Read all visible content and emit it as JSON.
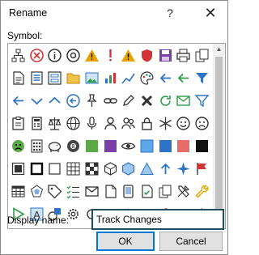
{
  "dialog": {
    "title": "Rename",
    "help_glyph": "?",
    "close_glyph": "✕"
  },
  "symbol_label": "Symbol:",
  "symbol_label_accel": "y",
  "display_name": {
    "label": "Display name:",
    "label_accel": "N",
    "value": "Track Changes"
  },
  "buttons": {
    "ok": "OK",
    "cancel": "Cancel"
  },
  "colors": {
    "accent_blue": "#2e74c6",
    "red": "#d13438",
    "orange": "#e8a200",
    "green": "#2e9e48",
    "purple": "#7a3fa8",
    "focus_border": "#1f4e5e"
  },
  "symbols": [
    [
      "sitemap-icon",
      "circle-x-icon",
      "info-icon",
      "at-icon",
      "warning-icon",
      "exclamation-icon",
      "warning-icon-2",
      "shield-icon",
      "save-icon",
      "print-icon",
      "copy-icon"
    ],
    [
      "document-icon",
      "document-list-icon",
      "form-icon",
      "folder-icon",
      "image-icon",
      "chart-icon",
      "chart-line-icon",
      "palette-icon",
      "arrow-left-icon",
      "arrow-left-2-icon",
      "filter-icon"
    ],
    [
      "arrow-left-icon",
      "chevron-down-icon",
      "chevron-up-icon",
      "arrow-left-circle-icon",
      "pin-icon",
      "link-icon",
      "pen-icon",
      "bold-x-icon",
      "refresh-icon",
      "mail-icon",
      "filter-outline-icon"
    ],
    [
      "clipboard-icon",
      "calculator-icon",
      "scales-icon",
      "globe-icon",
      "microphone-icon",
      "person-icon",
      "people-icon",
      "lock-icon",
      "snowflake-icon",
      "smile-icon",
      "sad-icon"
    ],
    [
      "sad-face-icon",
      "numpad-icon",
      "piggy-bank-icon",
      "number-8-icon",
      "swatch-green-icon",
      "swatch-purple-icon",
      "eye-icon",
      "swatch-blue-icon",
      "swatch-blue-dark-icon",
      "swatch-red-icon",
      "swatch-black-icon"
    ],
    [
      "box-icon",
      "box-bold-icon",
      "box-corners-icon",
      "grid-icon",
      "checker-icon",
      "cube-icon",
      "cube-blue-icon",
      "triangle-icon",
      "arrow-up-icon",
      "sparkle-icon",
      "flag-icon"
    ],
    [
      "table-icon",
      "spider-icon",
      "tag-icon",
      "checklist-icon",
      "envelope-icon",
      "page-icon",
      "tablet-icon",
      "document-ok-icon",
      "pages-icon",
      "tools-icon",
      "wrench-icon"
    ],
    [
      "play-icon",
      "text-a-icon",
      "shapes-icon",
      "settings-gear-icon",
      "refresh-2-icon",
      "eraser-icon",
      "star-icon",
      "checkmark-icon",
      "office-icon",
      "mail-edit-icon",
      "envelope-open-icon"
    ]
  ]
}
